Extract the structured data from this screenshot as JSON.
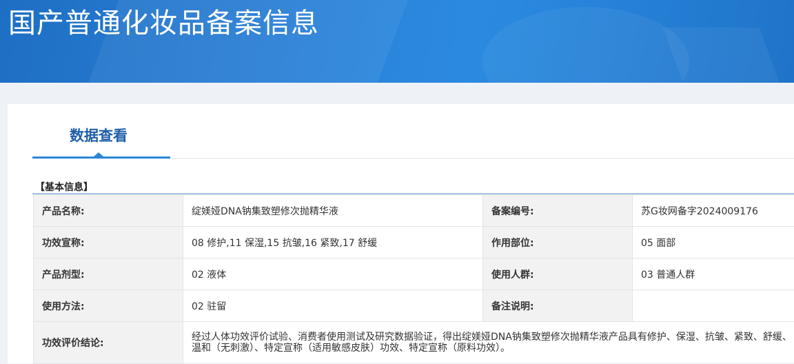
{
  "banner": {
    "title": "国产普通化妆品备案信息"
  },
  "tabs": {
    "active_label": "数据查看"
  },
  "section": {
    "title": "【基本信息】"
  },
  "rows": [
    {
      "label_left": "产品名称:",
      "value_left": "绽媄娅DNA钠集致塑修次抛精华液",
      "label_right": "备案编号:",
      "value_right": "苏G妆网备字2024009176"
    },
    {
      "label_left": "功效宣称:",
      "value_left": "08 修护,11 保湿,15 抗皱,16 紧致,17 舒缓",
      "label_right": "作用部位:",
      "value_right": "05 面部"
    },
    {
      "label_left": "产品剂型:",
      "value_left": "02 液体",
      "label_right": "使用人群:",
      "value_right": "03 普通人群"
    },
    {
      "label_left": "使用方法:",
      "value_left": "02 驻留",
      "label_right": "备注说明:",
      "value_right": ""
    }
  ],
  "conclusion": {
    "label": "功效评价结论:",
    "value": "经过人体功效评价试验、消费者使用测试及研究数据验证，得出绽媄娅DNA钠集致塑修次抛精华液产品具有修护、保湿、抗皱、紧致、舒缓、温和（无刺激）、特定宣称（适用敏感皮肤）功效、特定宣称（原料功效）。"
  }
}
